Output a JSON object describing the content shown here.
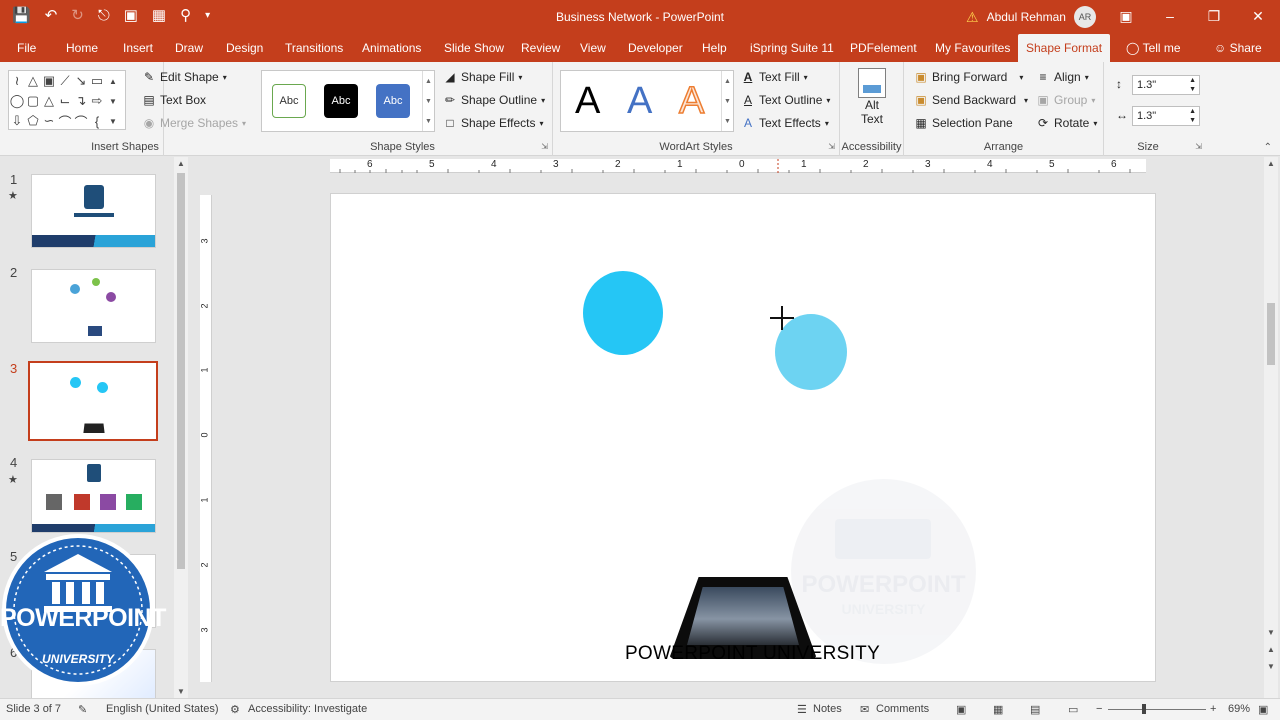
{
  "window": {
    "title": "Business Network  -  PowerPoint",
    "user_name": "Abdul Rehman",
    "user_initials": "AR"
  },
  "tabs": [
    {
      "label": "File"
    },
    {
      "label": "Home"
    },
    {
      "label": "Insert"
    },
    {
      "label": "Draw"
    },
    {
      "label": "Design"
    },
    {
      "label": "Transitions"
    },
    {
      "label": "Animations"
    },
    {
      "label": "Slide Show"
    },
    {
      "label": "Review"
    },
    {
      "label": "View"
    },
    {
      "label": "Developer"
    },
    {
      "label": "Help"
    },
    {
      "label": "iSpring Suite 11"
    },
    {
      "label": "PDFelement"
    },
    {
      "label": "My Favourites"
    },
    {
      "label": "Shape Format"
    },
    {
      "label": "Tell me"
    },
    {
      "label": "Share"
    }
  ],
  "ribbon": {
    "insert_shapes": {
      "label": "Insert Shapes",
      "edit_shape": "Edit Shape",
      "text_box": "Text Box",
      "merge_shapes": "Merge Shapes"
    },
    "shape_styles": {
      "label": "Shape Styles",
      "presets": [
        "Abc",
        "Abc",
        "Abc"
      ],
      "shape_fill": "Shape Fill",
      "shape_outline": "Shape Outline",
      "shape_effects": "Shape Effects"
    },
    "wordart_styles": {
      "label": "WordArt Styles",
      "letters": [
        "A",
        "A",
        "A"
      ],
      "text_fill": "Text Fill",
      "text_outline": "Text Outline",
      "text_effects": "Text Effects"
    },
    "accessibility": {
      "label": "Accessibility",
      "alt_text_line1": "Alt",
      "alt_text_line2": "Text"
    },
    "arrange": {
      "label": "Arrange",
      "bring_forward": "Bring Forward",
      "send_backward": "Send Backward",
      "selection_pane": "Selection Pane",
      "align": "Align",
      "group": "Group",
      "rotate": "Rotate"
    },
    "size": {
      "label": "Size",
      "height": "1.3\"",
      "width": "1.3\""
    }
  },
  "slides_panel": {
    "numbers": [
      "1",
      "2",
      "3",
      "4",
      "5",
      "6"
    ],
    "active_slide": "3"
  },
  "ruler": {
    "h_ticks": [
      "6",
      "5",
      "4",
      "3",
      "2",
      "1",
      "0",
      "1",
      "2",
      "3",
      "4",
      "5",
      "6"
    ],
    "v_ticks": [
      "3",
      "2",
      "1",
      "0",
      "1",
      "2",
      "3"
    ]
  },
  "slide": {
    "caption": "POWERPOINT UNIVERSITY",
    "watermark_line1": "POWERPOINT",
    "watermark_line2": "UNIVERSITY",
    "colors": {
      "circle_main": "#25c6f5",
      "circle_light": "#6dd3f2"
    }
  },
  "logo": {
    "line1": "POWERPOINT",
    "line2": "UNIVERSITY"
  },
  "status": {
    "slide_info": "Slide 3 of 7",
    "language": "English (United States)",
    "accessibility": "Accessibility: Investigate",
    "notes": "Notes",
    "comments": "Comments",
    "zoom": "69%"
  },
  "colors": {
    "accent": "#c43e1c",
    "ribbon_bg": "#f3f3f3"
  }
}
